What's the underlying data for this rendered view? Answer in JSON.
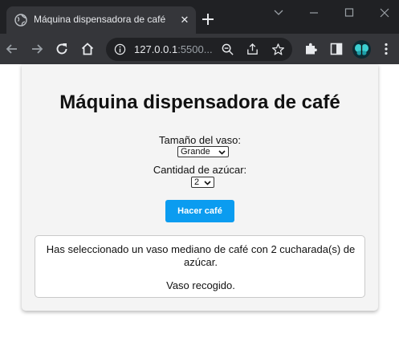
{
  "browser": {
    "tab_title": "Máquina dispensadora de café",
    "url_host": "127.0.0.1",
    "url_port": ":5500..."
  },
  "page": {
    "heading": "Máquina dispensadora de café",
    "cup_size_label": "Tamaño del vaso:",
    "cup_size_selected": "Grande",
    "sugar_label": "Cantidad de azúcar:",
    "sugar_selected": "2",
    "make_button": "Hacer café",
    "result_line1": "Has seleccionado un vaso mediano de café con 2 cucharada(s) de",
    "result_line2": "azúcar.",
    "result_line3": "Vaso recogido."
  },
  "colors": {
    "button_accent": "#0b9cf0",
    "card_background": "#f4f4f4"
  }
}
